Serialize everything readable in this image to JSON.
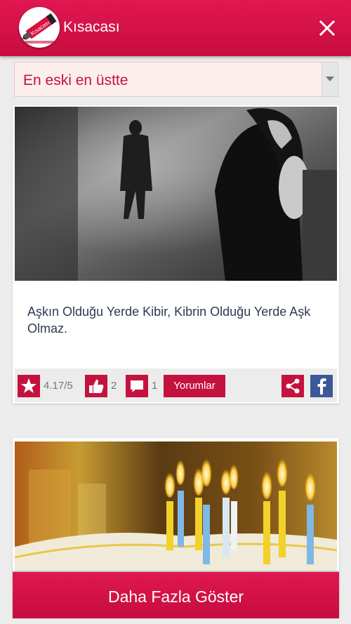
{
  "app": {
    "title": "Kısacası",
    "logo_text": "Kısacası"
  },
  "sort": {
    "selected": "En eski en üstte"
  },
  "posts": [
    {
      "text": "Aşkın Olduğu Yerde Kibir, Kibrin Olduğu Yerde Aşk Olmaz.",
      "rating": "4.17/5",
      "likes": "2",
      "comments": "1",
      "comments_button": "Yorumlar"
    }
  ],
  "more_button": "Daha Fazla Göster",
  "colors": {
    "primary": "#c4123f",
    "facebook": "#3b5998"
  }
}
